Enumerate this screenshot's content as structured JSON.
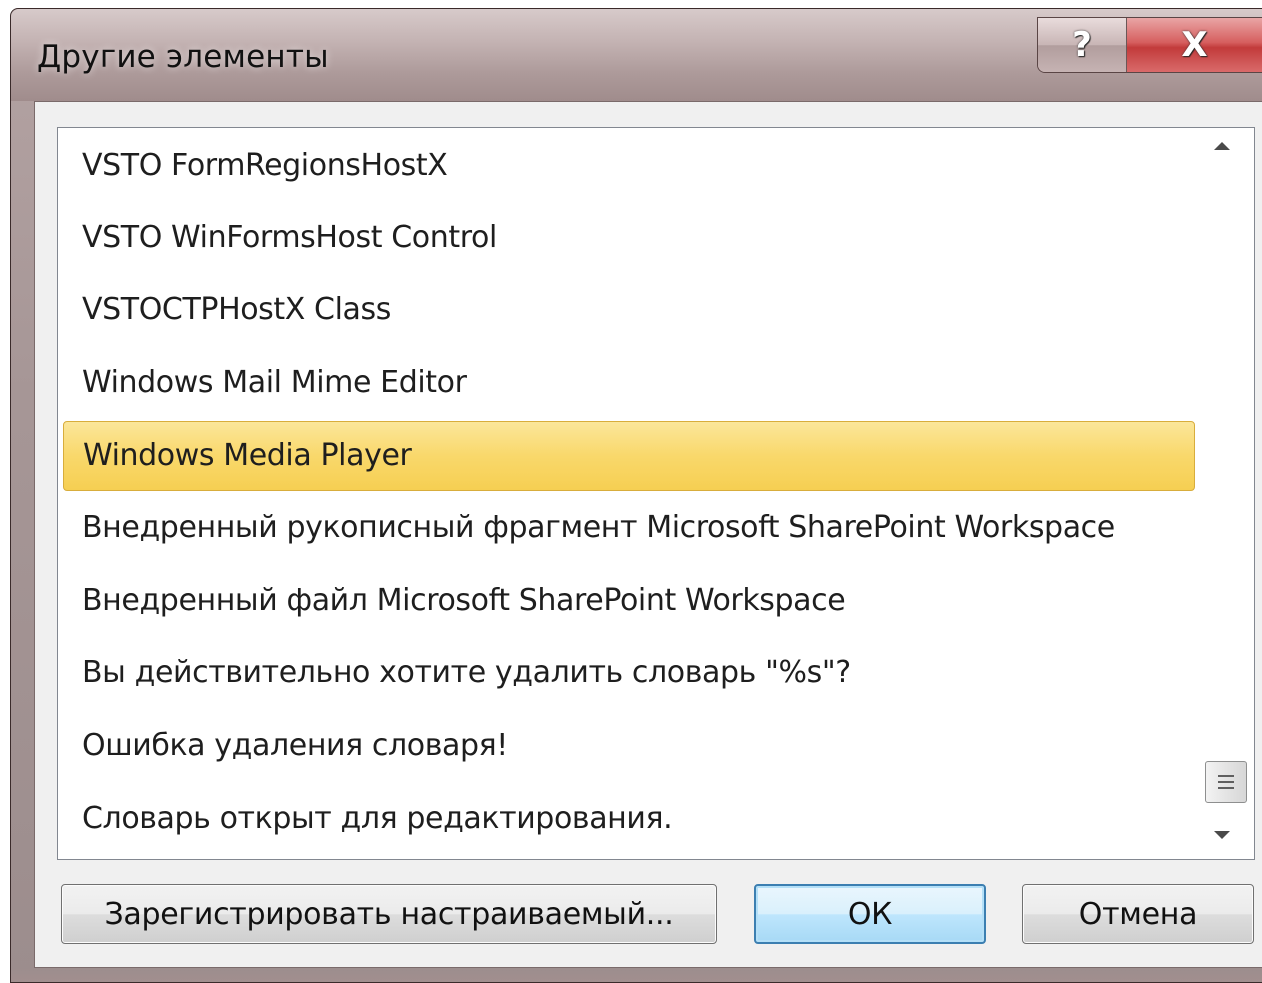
{
  "window": {
    "title": "Другие элементы",
    "help_glyph": "?",
    "close_glyph": "X"
  },
  "list": {
    "items": [
      {
        "label": "VSTO FormRegionsHostX",
        "selected": false
      },
      {
        "label": "VSTO WinFormsHost Control",
        "selected": false
      },
      {
        "label": "VSTOCTPHostX Class",
        "selected": false
      },
      {
        "label": "Windows Mail Mime Editor",
        "selected": false
      },
      {
        "label": "Windows Media Player",
        "selected": true
      },
      {
        "label": "Внедренный рукописный фрагмент Microsoft SharePoint Workspace",
        "selected": false
      },
      {
        "label": "Внедренный файл Microsoft SharePoint Workspace",
        "selected": false
      },
      {
        "label": "Вы действительно хотите удалить словарь \"%s\"?",
        "selected": false
      },
      {
        "label": "Ошибка удаления словаря!",
        "selected": false
      },
      {
        "label": "Словарь открыт для редактирования.",
        "selected": false
      }
    ],
    "selected_color": "#f9d86b"
  },
  "buttons": {
    "register_label": "Зарегистрировать настраиваемый...",
    "ok_label": "ОК",
    "cancel_label": "Отмена"
  }
}
